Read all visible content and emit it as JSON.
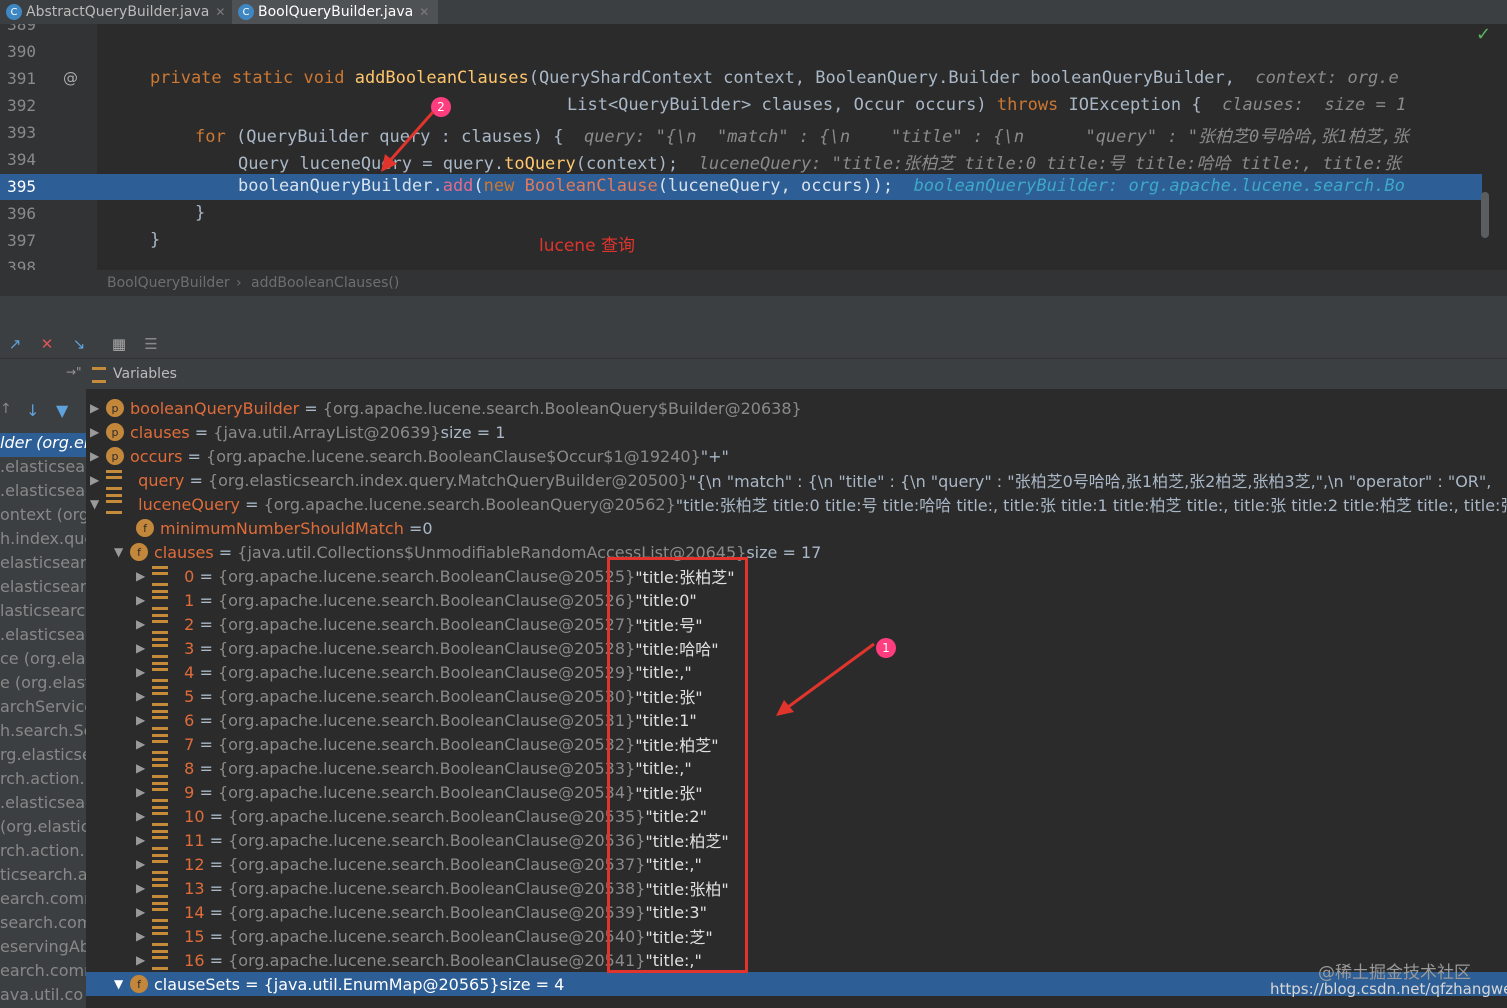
{
  "tabs": [
    {
      "icon": "C",
      "label": "AbstractQueryBuilder.java"
    },
    {
      "icon": "C",
      "label": "BoolQueryBuilder.java"
    }
  ],
  "editor": {
    "line_numbers": [
      "389",
      "390",
      "391",
      "392",
      "393",
      "394",
      "395",
      "396",
      "397",
      "398"
    ],
    "at_marker": "@",
    "lines": {
      "l391": {
        "kw": "private static void ",
        "fn": "addBooleanClauses",
        "rest": "(QueryShardContext context, BooleanQuery.Builder booleanQueryBuilder,",
        "hint": "  context: org.e"
      },
      "l392": {
        "rest": "List<QueryBuilder> clauses, Occur occurs) ",
        "kw": "throws",
        "rest2": " IOException {",
        "hint": "  clauses:  size = 1"
      },
      "l393": {
        "kw": "for",
        "rest": " (QueryBuilder query : clauses) {",
        "hint": "  query: \"{\\n  \"match\" : {\\n    \"title\" : {\\n      \"query\" : \"张柏芝0号哈哈,张1柏芝,张"
      },
      "l394": {
        "rest": "Query luceneQuery = query.",
        "fn": "toQuery",
        "rest2": "(context);",
        "hint": "  luceneQuery: \"title:张柏芝 title:0 title:号 title:哈哈 title:, title:张"
      },
      "l395": {
        "rest": "booleanQueryBuilder.",
        "fn": "add",
        "kw": "new ",
        "fn2": "BooleanClause",
        "rest2": "(luceneQuery, occurs));",
        "hint": "  booleanQueryBuilder: org.apache.lucene.search.Bo"
      },
      "l396": {
        "rest": "}"
      },
      "l397": {
        "rest": "}"
      }
    },
    "annotation": "lucene 查询",
    "badge2": "2"
  },
  "breadcrumb": [
    "BoolQueryBuilder",
    "›",
    "addBooleanClauses()"
  ],
  "variables_title": "Variables",
  "frames": [
    "lder (org.el",
    ".elasticsear",
    ".elasticsear",
    "ontext (org",
    "h.index.que",
    "elasticsear",
    "elasticsear",
    "lasticsearch",
    ".elasticsear",
    "ce (org.elas",
    "e (org.elasti",
    "archService",
    "h.search.Se",
    "rg.elasticse",
    "rch.action.",
    ".elasticsear",
    "(org.elastic",
    "rch.action.",
    "ticsearch.a",
    "earch.comm",
    "search.com",
    "eservingAb",
    "earch.comm",
    "ava.util.co"
  ],
  "vars": [
    {
      "name": "booleanQueryBuilder",
      "ref": "{org.apache.lucene.search.BooleanQuery$Builder@20638}",
      "extra": ""
    },
    {
      "name": "clauses",
      "ref": "{java.util.ArrayList@20639}",
      "extra": " size = 1"
    },
    {
      "name": "occurs",
      "ref": "{org.apache.lucene.search.BooleanClause$Occur$1@19240}",
      "extra": " \"+\""
    },
    {
      "name": "query",
      "ref": "{org.elasticsearch.index.query.MatchQueryBuilder@20500}",
      "extra": " \"{\\n  \"match\" : {\\n    \"title\" : {\\n      \"query\" : \"张柏芝0号哈哈,张1柏芝,张2柏芝,张柏3芝,\",\\n      \"operator\" : \"OR\","
    },
    {
      "name": "luceneQuery",
      "ref": "{org.apache.lucene.search.BooleanQuery@20562}",
      "extra": " \"title:张柏芝 title:0 title:号 title:哈哈 title:, title:张 title:1 title:柏芝 title:, title:张 title:2 title:柏芝 title:, title:张柏 ti"
    },
    {
      "name": "minimumNumberShouldMatch",
      "ref": "",
      "extra": " 0"
    },
    {
      "name": "clauses",
      "ref": "{java.util.Collections$UnmodifiableRandomAccessList@20645}",
      "extra": " size = 17"
    }
  ],
  "clauses": [
    {
      "i": "0",
      "ref": "{org.apache.lucene.search.BooleanClause@20525}",
      "val": "\"title:张柏芝\""
    },
    {
      "i": "1",
      "ref": "{org.apache.lucene.search.BooleanClause@20526}",
      "val": "\"title:0\""
    },
    {
      "i": "2",
      "ref": "{org.apache.lucene.search.BooleanClause@20527}",
      "val": "\"title:号\""
    },
    {
      "i": "3",
      "ref": "{org.apache.lucene.search.BooleanClause@20528}",
      "val": "\"title:哈哈\""
    },
    {
      "i": "4",
      "ref": "{org.apache.lucene.search.BooleanClause@20529}",
      "val": "\"title:,\""
    },
    {
      "i": "5",
      "ref": "{org.apache.lucene.search.BooleanClause@20530}",
      "val": "\"title:张\""
    },
    {
      "i": "6",
      "ref": "{org.apache.lucene.search.BooleanClause@20531}",
      "val": "\"title:1\""
    },
    {
      "i": "7",
      "ref": "{org.apache.lucene.search.BooleanClause@20532}",
      "val": "\"title:柏芝\""
    },
    {
      "i": "8",
      "ref": "{org.apache.lucene.search.BooleanClause@20533}",
      "val": "\"title:,\""
    },
    {
      "i": "9",
      "ref": "{org.apache.lucene.search.BooleanClause@20534}",
      "val": "\"title:张\""
    },
    {
      "i": "10",
      "ref": "{org.apache.lucene.search.BooleanClause@20535}",
      "val": "\"title:2\""
    },
    {
      "i": "11",
      "ref": "{org.apache.lucene.search.BooleanClause@20536}",
      "val": "\"title:柏芝\""
    },
    {
      "i": "12",
      "ref": "{org.apache.lucene.search.BooleanClause@20537}",
      "val": "\"title:,\""
    },
    {
      "i": "13",
      "ref": "{org.apache.lucene.search.BooleanClause@20538}",
      "val": "\"title:张柏\""
    },
    {
      "i": "14",
      "ref": "{org.apache.lucene.search.BooleanClause@20539}",
      "val": "\"title:3\""
    },
    {
      "i": "15",
      "ref": "{org.apache.lucene.search.BooleanClause@20540}",
      "val": "\"title:芝\""
    },
    {
      "i": "16",
      "ref": "{org.apache.lucene.search.BooleanClause@20541}",
      "val": "\"title:,\""
    }
  ],
  "clauseSets": {
    "name": "clauseSets",
    "ref": "{java.util.EnumMap@20565}",
    "extra": " size = 4"
  },
  "badge1": "1",
  "watermark": {
    "line1": "@稀土掘金技术社区",
    "line2": "https://blog.csdn.net/qfzhangwei"
  }
}
